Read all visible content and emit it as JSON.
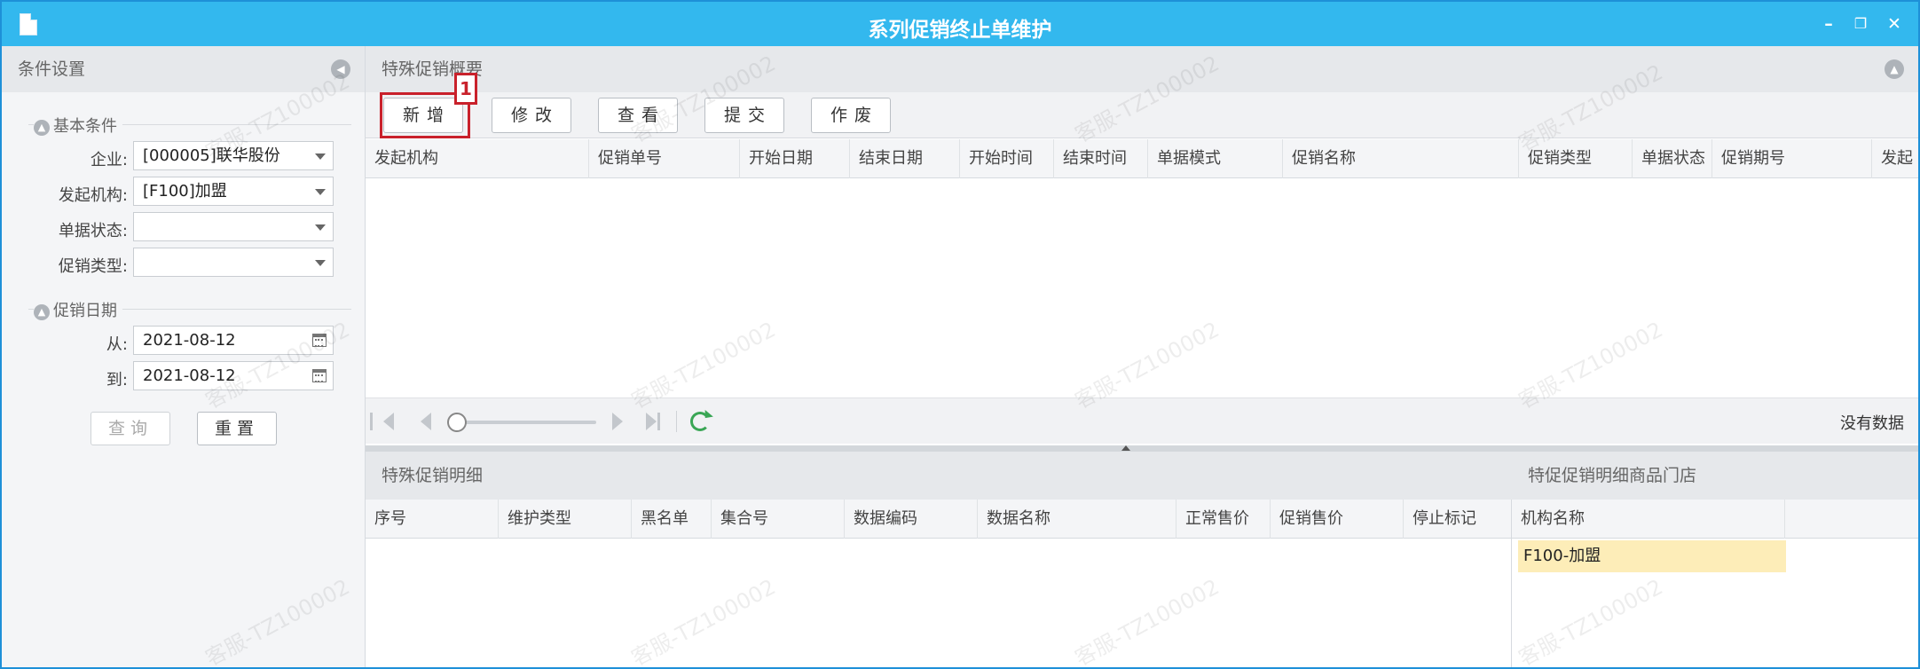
{
  "window": {
    "title": "系列促销终止单维护",
    "icons": {
      "doc": "document-icon",
      "minimize": "minimize-icon",
      "restore": "restore-icon",
      "close": "close-icon"
    },
    "minimize_glyph": "–",
    "restore_glyph": "❐",
    "close_glyph": "✕"
  },
  "conditions": {
    "header": "条件设置",
    "basic_group": "基本条件",
    "enterprise_label": "企业:",
    "enterprise_value": "[000005]联华股份",
    "org_label": "发起机构:",
    "org_value": "[F100]加盟",
    "status_label": "单据状态:",
    "status_value": "",
    "type_label": "促销类型:",
    "type_value": "",
    "date_group": "促销日期",
    "from_label": "从:",
    "from_value": "2021-08-12",
    "to_label": "到:",
    "to_value": "2021-08-12",
    "query_button": "查询",
    "reset_button": "重置"
  },
  "overview": {
    "header": "特殊促销概要",
    "toolbar": {
      "add": "新增",
      "edit": "修改",
      "view": "查看",
      "submit": "提交",
      "void": "作废"
    },
    "step_badge": "1",
    "columns": [
      "发起机构",
      "促销单号",
      "开始日期",
      "结束日期",
      "开始时间",
      "结束时间",
      "单据模式",
      "促销名称",
      "促销类型",
      "单据状态",
      "促销期号",
      "发起"
    ],
    "pager": {
      "status": "没有数据"
    }
  },
  "detail": {
    "header": "特殊促销明细",
    "columns": [
      "序号",
      "维护类型",
      "黑名单",
      "集合号",
      "数据编码",
      "数据名称",
      "正常售价",
      "促销售价",
      "停止标记"
    ]
  },
  "store": {
    "header": "特促促销明细商品门店",
    "column": "机构名称",
    "rows": [
      "F100-加盟"
    ]
  },
  "watermark": "客服-TZ100002",
  "colors": {
    "titlebar": "#33b8ee",
    "highlight": "#c9212b",
    "selected_row": "#fdedb8"
  }
}
